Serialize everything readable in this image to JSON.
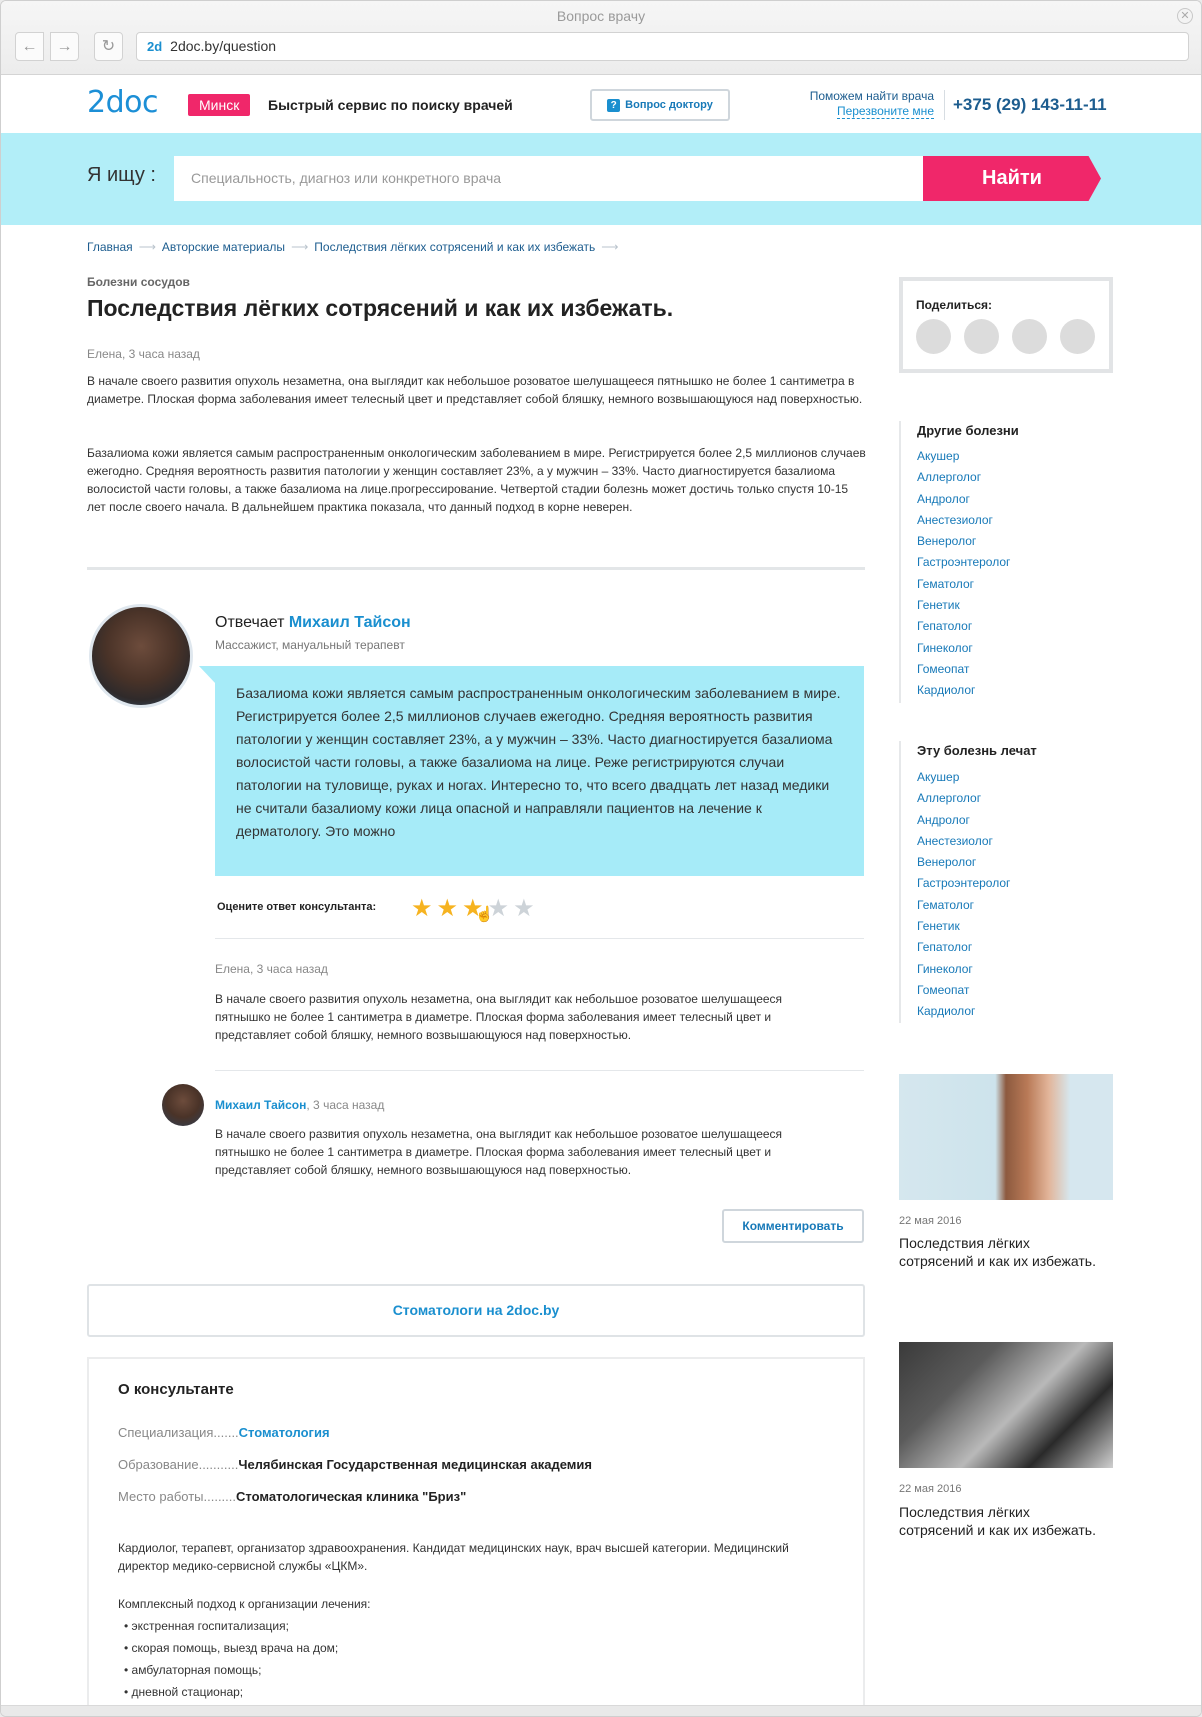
{
  "window": {
    "title": "Вопрос врачу",
    "url": "2doc.by/question",
    "favicon": "2d"
  },
  "header": {
    "logo": "2doc",
    "city": "Минск",
    "tagline": "Быстрый сервис по поиску врачей",
    "ask_button": "Вопрос доктору",
    "help_line": "Поможем найти врача",
    "callback": "Перезвоните мне",
    "phone": "+375 (29) 143-11-11"
  },
  "search": {
    "label": "Я ищу :",
    "placeholder": "Специальность, диагноз или конкретного врача",
    "button": "Найти"
  },
  "breadcrumb": [
    "Главная",
    "Авторские материалы",
    "Последствия лёгких сотрясений и как их избежать"
  ],
  "article": {
    "category": "Болезни сосудов",
    "title": "Последствия лёгких сотрясений и как их избежать.",
    "meta": "Елена, 3 часа назад",
    "para1": "В начале своего развития опухоль незаметна, она выглядит как небольшое розоватое шелушащееся пятнышко не более 1 сантиметра в диаметре. Плоская форма заболевания имеет телесный цвет и представляет собой бляшку, немного возвышающуюся над поверхностью.",
    "para2": "Базалиома кожи является самым распространенным онкологическим заболеванием в мире. Регистрируется более 2,5 миллионов случаев ежегодно. Средняя вероятность развития патологии у женщин составляет 23%, а у мужчин – 33%. Часто диагностируется базалиома волосистой части головы, а также базалиома на лице.прогрессирование. Четвертой стадии болезнь может достичь только спустя 10-15 лет после своего начала. В дальнейшем практика показала, что данный подход в корне неверен."
  },
  "answer": {
    "prefix": "Отвечает",
    "name": "Михаил Тайсон",
    "role": "Массажист, мануальный терапевт",
    "text": "Базалиома кожи является самым распространенным онкологическим заболеванием в мире. Регистрируется более 2,5 миллионов случаев ежегодно. Средняя вероятность развития патологии у женщин составляет 23%, а у мужчин – 33%. Часто диагностируется базалиома волосистой части головы, а также базалиома на лице. Реже регистрируются случаи патологии на туловище, руках и ногах. Интересно то, что всего двадцать лет назад медики не считали базалиому кожи лица опасной и направляли пациентов на лечение к дерматологу. Это можно",
    "rate_label": "Оцените ответ консультанта:",
    "rating": 3,
    "rating_max": 5
  },
  "comment": {
    "meta": "Елена, 3 часа назад",
    "text": "В начале своего развития опухоль незаметна, она выглядит как небольшое розоватое шелушащееся пятнышко не более 1 сантиметра в диаметре. Плоская форма заболевания имеет телесный цвет и представляет собой бляшку, немного возвышающуюся над поверхностью."
  },
  "reply": {
    "name": "Михаил Тайсон",
    "time": ", 3 часа назад",
    "text": "В начале своего развития опухоль незаметна, она выглядит как небольшое розоватое шелушащееся пятнышко не более 1 сантиметра в диаметре. Плоская форма заболевания имеет телесный цвет и представляет собой бляшку, немного возвышающуюся над поверхностью."
  },
  "comment_button": "Комментировать",
  "stoma_button": "Стоматологи на 2doc.by",
  "about": {
    "title": "О консультанте",
    "spec_label": "Специализация.......",
    "spec": "Стоматология",
    "edu_label": "Образование...........",
    "edu": "Челябинская Государственная медицинская академия",
    "work_label": "Место работы.........",
    "work": "Стоматологическая клиника \"Бриз\"",
    "bio": "Кардиолог, терапевт, организатор здравоохранения. Кандидат медицинских наук, врач высшей категории. Медицинский директор медико-сервисной службы «ЦКМ».",
    "approach": "Комплексный подход к организации лечения:",
    "items": [
      "• экстренная госпитализация;",
      "• скорая помощь, выезд врача на дом;",
      "• амбулаторная помощь;",
      "• дневной стационар;"
    ]
  },
  "sidebar": {
    "share": "Поделиться:",
    "other_title": "Другие болезни",
    "other": [
      "Акушер",
      "Аллерголог",
      "Андролог",
      "Анестезиолог",
      "Венеролог",
      "Гастроэнтеролог",
      "Гематолог",
      "Генетик",
      "Гепатолог",
      "Гинеколог",
      "Гомеопат",
      "Кардиолог"
    ],
    "treat_title": "Эту болезнь лечат",
    "treat": [
      "Акушер",
      "Аллерголог",
      "Андролог",
      "Анестезиолог",
      "Венеролог",
      "Гастроэнтеролог",
      "Гематолог",
      "Генетик",
      "Гепатолог",
      "Гинеколог",
      "Гомеопат",
      "Кардиолог"
    ],
    "cards": [
      {
        "date": "22 мая 2016",
        "title": "Последствия лёгких сотрясений и как их избежать."
      },
      {
        "date": "22 мая 2016",
        "title": "Последствия лёгких сотрясений и как их избежать."
      }
    ]
  },
  "colors": {
    "brand": "#1a8fcf",
    "accent": "#f0276a",
    "band": "#b2eef8",
    "bubble": "#a6ebf8",
    "star": "#f6b320"
  }
}
